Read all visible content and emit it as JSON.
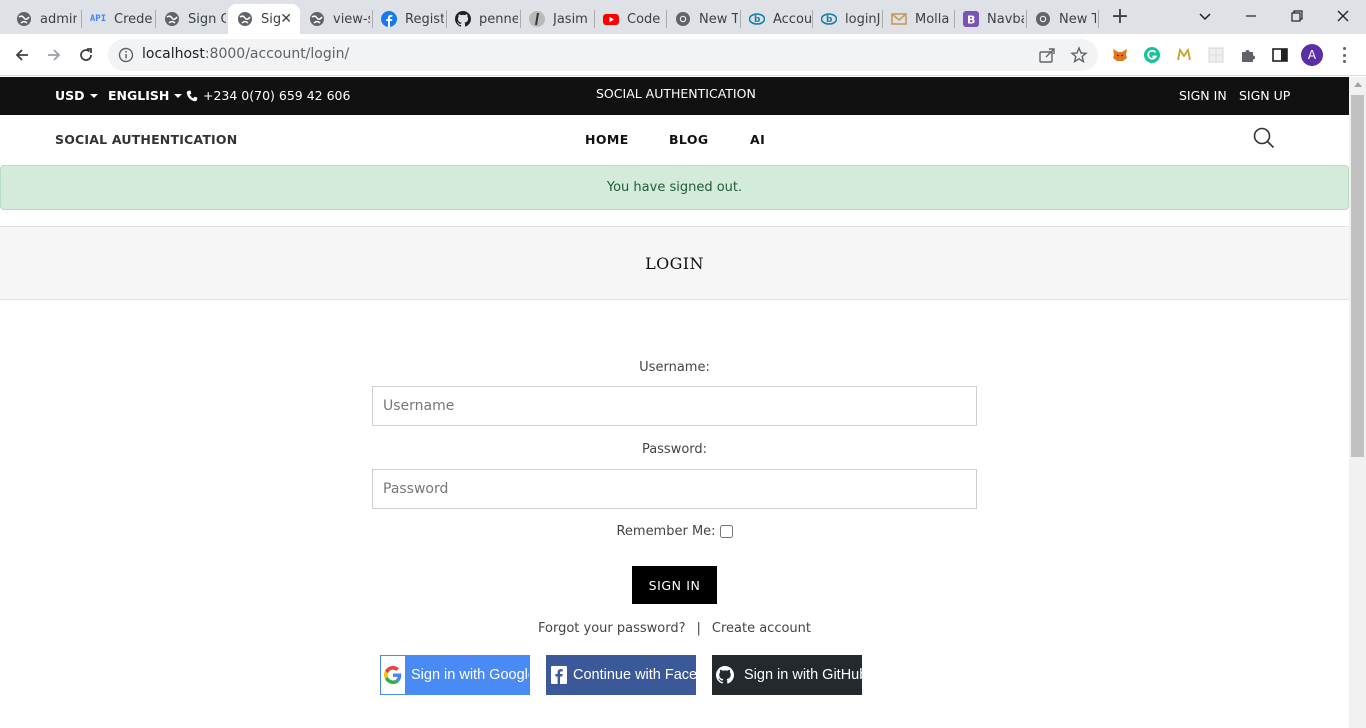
{
  "browser": {
    "tabs": [
      {
        "title": "admin",
        "icon": "globe-icon"
      },
      {
        "title": "Crede",
        "icon": "api-icon"
      },
      {
        "title": "Sign C",
        "icon": "globe-icon"
      },
      {
        "title": "Sig",
        "icon": "globe-icon",
        "active": true
      },
      {
        "title": "view-s",
        "icon": "globe-icon"
      },
      {
        "title": "Regist",
        "icon": "facebook-icon"
      },
      {
        "title": "penne",
        "icon": "github-icon"
      },
      {
        "title": "Jasim",
        "icon": "avatar-icon"
      },
      {
        "title": "Code",
        "icon": "youtube-icon"
      },
      {
        "title": "New T",
        "icon": "chrome-icon"
      },
      {
        "title": "Accou",
        "icon": "b-eye-icon"
      },
      {
        "title": "loginJ",
        "icon": "b-eye-icon"
      },
      {
        "title": "Molla",
        "icon": "gmail-icon"
      },
      {
        "title": "Navba",
        "icon": "bootstrap-icon"
      },
      {
        "title": "New T",
        "icon": "chrome-icon"
      }
    ],
    "tab_api_badge": "API",
    "new_tab_label": "+",
    "url_host": "localhost",
    "url_rest": ":8000/account/login/",
    "profile_initial": "A",
    "extensions": [
      "metamask-icon",
      "grammarly-icon",
      "m-icon",
      "blank-ext-icon",
      "puzzle-icon"
    ]
  },
  "site": {
    "topbar": {
      "currency": "USD",
      "language": "ENGLISH",
      "phone": "+234 0(70) 659 42 606",
      "center_title": "SOCIAL AUTHENTICATION",
      "sign_in": "SIGN IN",
      "sign_up": "SIGN UP"
    },
    "nav": {
      "brand": "SOCIAL AUTHENTICATION",
      "links": [
        "HOME",
        "BLOG",
        "AI"
      ]
    },
    "alert": "You have signed out.",
    "page_title": "LOGIN",
    "form": {
      "username_label": "Username:",
      "username_placeholder": "Username",
      "password_label": "Password:",
      "password_placeholder": "Password",
      "remember_label": "Remember Me:",
      "remember_checked": false,
      "submit_label": "SIGN IN",
      "forgot_link": "Forgot your password?",
      "separator": "|",
      "create_link": "Create account"
    },
    "social": {
      "google_label": "Sign in with Google",
      "facebook_label": "Continue with Facebook",
      "github_label": "Sign in with GitHub"
    },
    "colors": {
      "topbar_bg": "#111111",
      "alert_bg": "#d4ebdc",
      "alert_text": "#1f5d33",
      "google_blue": "#4a8af4",
      "facebook_blue": "#3b5998",
      "github_dark": "#24292e"
    }
  }
}
